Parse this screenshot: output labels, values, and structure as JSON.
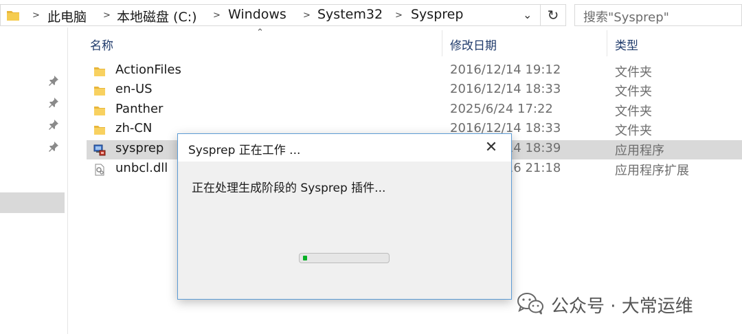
{
  "address_bar": {
    "breadcrumbs": [
      "此电脑",
      "本地磁盘 (C:)",
      "Windows",
      "System32",
      "Sysprep"
    ]
  },
  "search": {
    "placeholder": "搜索\"Sysprep\""
  },
  "columns": {
    "name": "名称",
    "date": "修改日期",
    "type": "类型"
  },
  "files": [
    {
      "name": "ActionFiles",
      "date": "2016/12/14 19:12",
      "type": "文件夹",
      "icon": "folder-icon"
    },
    {
      "name": "en-US",
      "date": "2016/12/14 18:33",
      "type": "文件夹",
      "icon": "folder-icon"
    },
    {
      "name": "Panther",
      "date": "2025/6/24 17:22",
      "type": "文件夹",
      "icon": "folder-icon"
    },
    {
      "name": "zh-CN",
      "date": "2016/12/14 18:33",
      "type": "文件夹",
      "icon": "folder-icon"
    },
    {
      "name": "sysprep",
      "date": "2016/12/14 18:39",
      "type": "应用程序",
      "icon": "sysprep-app-icon",
      "selected": true
    },
    {
      "name": "unbcl.dll",
      "date": "2016/12/16 21:18",
      "type": "应用程序扩展",
      "icon": "dll-file-icon"
    }
  ],
  "dialog": {
    "title": "Sysprep 正在工作 ...",
    "message": "正在处理生成阶段的 Sysprep 插件...",
    "progress": 0.05,
    "accent_color": "#06b025"
  },
  "watermark": {
    "text": "公众号 · 大常运维"
  }
}
